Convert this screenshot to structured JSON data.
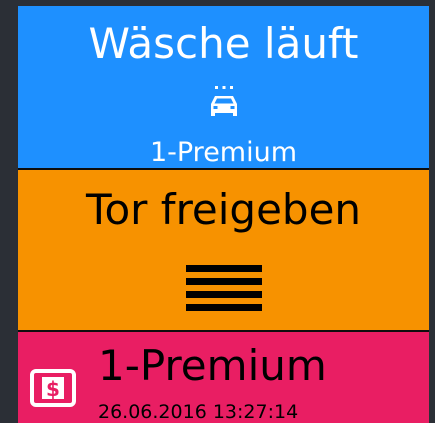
{
  "status": {
    "title": "Wäsche läuft",
    "icon": "car-wash-icon",
    "program": "1-Premium",
    "color": "#1e90ff"
  },
  "gate": {
    "title": "Tor freigeben",
    "icon": "menu-icon",
    "color": "#f79200"
  },
  "last_purchase": {
    "icon": "dollar-receipt-icon",
    "program": "1-Premium",
    "timestamp": "26.06.2016 13:27:14",
    "color": "#e91e63"
  }
}
